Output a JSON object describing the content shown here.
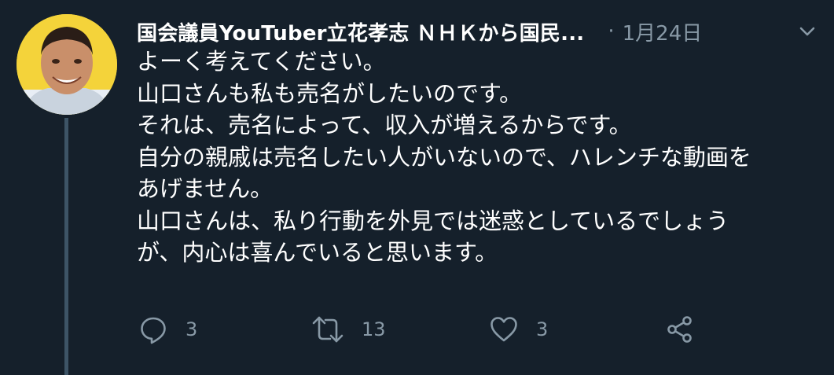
{
  "tweet": {
    "author_name": "国会議員YouTuber立花孝志 ＮＨＫから国民...",
    "dot": "·",
    "timestamp": "1月24日",
    "text_lines": [
      "よーく考えてください。",
      "山口さんも私も売名がしたいのです。",
      "それは、売名によって、収入が増えるからです。",
      "自分の親戚は売名したい人がいないので、ハレンチな動画を",
      "あげません。",
      "山口さんは、私り行動を外見では迷惑としているでしょう",
      "が、内心は喜んでいると思います。"
    ],
    "actions": {
      "reply_count": "3",
      "retweet_count": "13",
      "like_count": "3"
    }
  },
  "colors": {
    "background": "#15202b",
    "text": "#ffffff",
    "secondary": "#8899a6",
    "thread_line": "#3d5466",
    "avatar_bg": "#f4d33a"
  },
  "icons": [
    "chevron-down-icon",
    "reply-icon",
    "retweet-icon",
    "like-icon",
    "share-icon"
  ]
}
